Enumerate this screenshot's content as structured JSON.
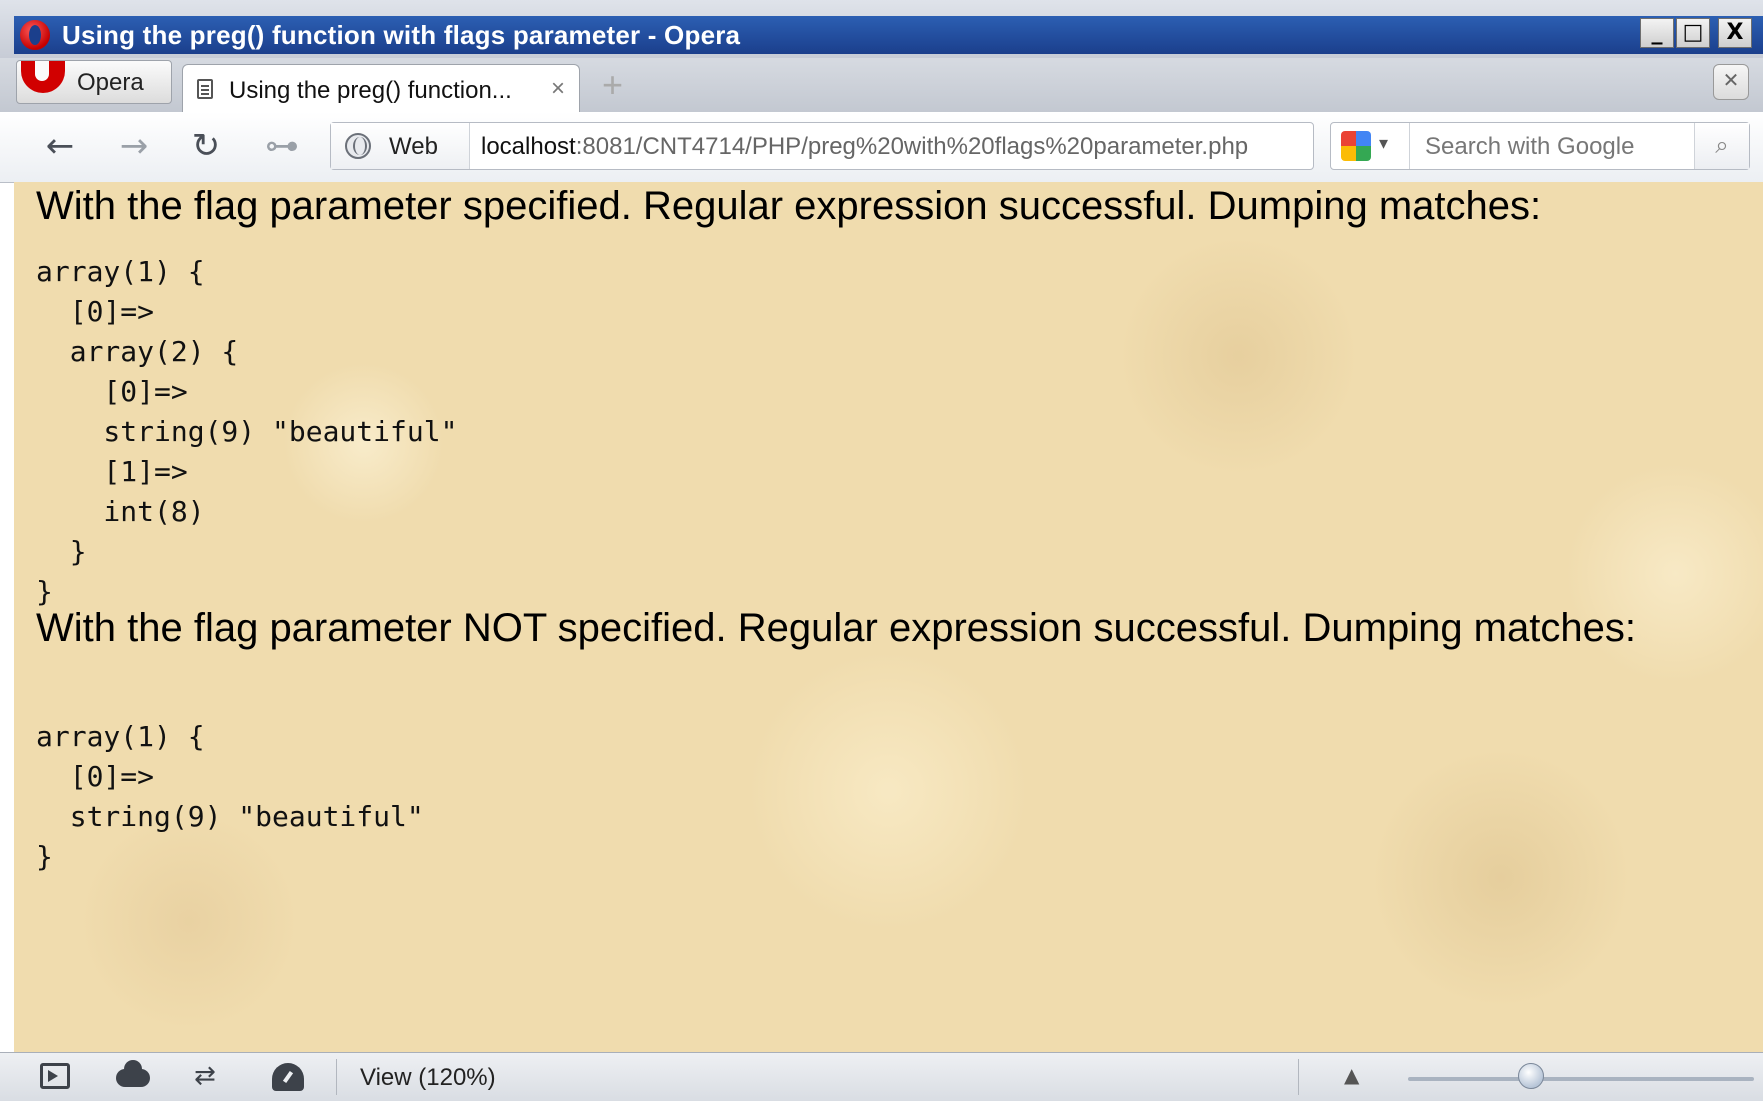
{
  "window": {
    "title": "Using the preg() function with flags parameter - Opera",
    "buttons": {
      "minimize": "_",
      "maximize": "□",
      "close": "X"
    }
  },
  "tabbar": {
    "menu_label": "Opera",
    "tab_label": "Using the preg() function...",
    "tab_close": "×",
    "new_tab": "+",
    "trash": "✕"
  },
  "navbar": {
    "back": "←",
    "forward": "→",
    "reload": "↻",
    "wand": "⊶",
    "web_label": "Web",
    "url_host": "localhost",
    "url_rest": ":8081/CNT4714/PHP/preg%20with%20flags%20parameter.php",
    "search_dropdown": "▾",
    "search_placeholder": "Search with Google",
    "search_button": "⌕"
  },
  "content": {
    "para1": "With the flag parameter specified. Regular expression successful. Dumping matches:",
    "code1": "array(1) {\n  [0]=>\n  array(2) {\n    [0]=>\n    string(9) \"beautiful\"\n    [1]=>\n    int(8)\n  }\n}",
    "para2": "With the flag parameter NOT specified. Regular expression successful. Dumping matches:",
    "code2": "array(1) {\n  [0]=>\n  string(9) \"beautiful\"\n}"
  },
  "status": {
    "share_glyph": "⇄",
    "view_label": "View (120%)",
    "zoom_arrow": "▲"
  },
  "colors": {
    "title_bar": "#1b3f8c",
    "content_bg": "#f0dcae",
    "opera_red": "#d10000"
  }
}
